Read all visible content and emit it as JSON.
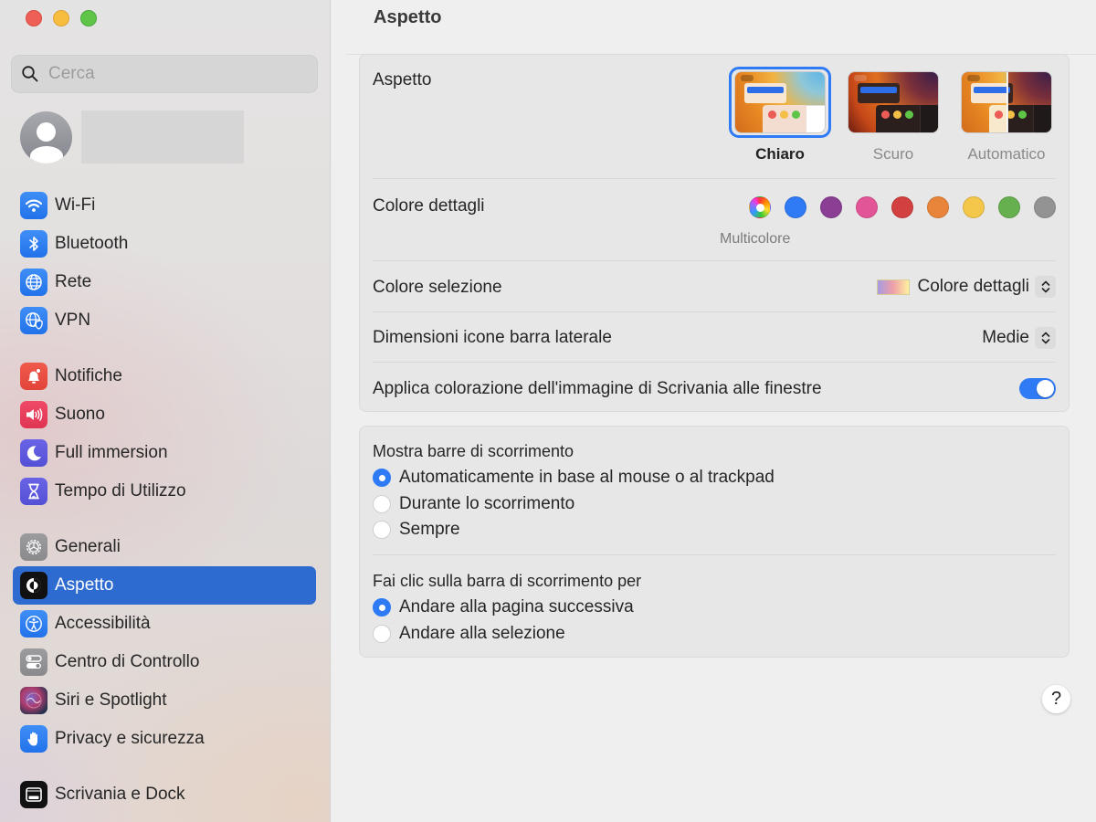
{
  "window": {
    "traffic_lights": [
      "close",
      "minimize",
      "zoom"
    ]
  },
  "sidebar": {
    "search": {
      "placeholder": "Cerca",
      "value": ""
    },
    "items": [
      {
        "id": "wifi",
        "label": "Wi-Fi",
        "icon": "wifi-icon",
        "icon_bg": "blue"
      },
      {
        "id": "bluetooth",
        "label": "Bluetooth",
        "icon": "bluetooth-icon",
        "icon_bg": "blue"
      },
      {
        "id": "rete",
        "label": "Rete",
        "icon": "globe-icon",
        "icon_bg": "blue"
      },
      {
        "id": "vpn",
        "label": "VPN",
        "icon": "vpn-globe-shield-icon",
        "icon_bg": "blue"
      },
      {
        "id": "notifiche",
        "label": "Notifiche",
        "icon": "bell-icon",
        "icon_bg": "red"
      },
      {
        "id": "suono",
        "label": "Suono",
        "icon": "speaker-icon",
        "icon_bg": "pink"
      },
      {
        "id": "full-immersion",
        "label": "Full immersion",
        "icon": "moon-icon",
        "icon_bg": "indigo"
      },
      {
        "id": "tempo",
        "label": "Tempo di Utilizzo",
        "icon": "hourglass-icon",
        "icon_bg": "indigo"
      },
      {
        "id": "generali",
        "label": "Generali",
        "icon": "gear-icon",
        "icon_bg": "gray"
      },
      {
        "id": "aspetto",
        "label": "Aspetto",
        "icon": "appearance-icon",
        "icon_bg": "black",
        "selected": true
      },
      {
        "id": "accessibilita",
        "label": "Accessibilità",
        "icon": "accessibility-icon",
        "icon_bg": "blue"
      },
      {
        "id": "centro-controllo",
        "label": "Centro di Controllo",
        "icon": "control-center-icon",
        "icon_bg": "gray"
      },
      {
        "id": "siri",
        "label": "Siri e Spotlight",
        "icon": "siri-icon",
        "icon_bg": "siri"
      },
      {
        "id": "privacy",
        "label": "Privacy e sicurezza",
        "icon": "hand-icon",
        "icon_bg": "blue"
      },
      {
        "id": "scrivania",
        "label": "Scrivania e Dock",
        "icon": "desktop-dock-icon",
        "icon_bg": "black"
      }
    ]
  },
  "main": {
    "title": "Aspetto",
    "appearance": {
      "label": "Aspetto",
      "options": [
        {
          "label": "Chiaro",
          "selected": true
        },
        {
          "label": "Scuro",
          "selected": false
        },
        {
          "label": "Automatico",
          "selected": false
        }
      ]
    },
    "accent": {
      "label": "Colore dettagli",
      "selected_label": "Multicolore",
      "colors": [
        {
          "name": "Multicolore",
          "hex": "multicolor",
          "selected": true
        },
        {
          "name": "blue",
          "hex": "#2f7bf5"
        },
        {
          "name": "purple",
          "hex": "#8a3f95"
        },
        {
          "name": "pink",
          "hex": "#e25597"
        },
        {
          "name": "red",
          "hex": "#d2413f"
        },
        {
          "name": "orange",
          "hex": "#e8853a"
        },
        {
          "name": "yellow",
          "hex": "#f4c74b"
        },
        {
          "name": "green",
          "hex": "#67b04f"
        },
        {
          "name": "graphite",
          "hex": "#939393"
        }
      ]
    },
    "highlight": {
      "label": "Colore selezione",
      "value": "Colore dettagli"
    },
    "sidebar_icon_size": {
      "label": "Dimensioni icone barra laterale",
      "value": "Medie"
    },
    "wallpaper_tinting": {
      "label": "Applica colorazione dell'immagine di Scrivania alle finestre",
      "enabled": true
    },
    "show_scroll_bars": {
      "title": "Mostra barre di scorrimento",
      "options": [
        {
          "label": "Automaticamente in base al mouse o al trackpad",
          "checked": true
        },
        {
          "label": "Durante lo scorrimento",
          "checked": false
        },
        {
          "label": "Sempre",
          "checked": false
        }
      ]
    },
    "click_scroll_bar": {
      "title": "Fai clic sulla barra di scorrimento per",
      "options": [
        {
          "label": "Andare alla pagina successiva",
          "checked": true
        },
        {
          "label": "Andare alla selezione",
          "checked": false
        }
      ]
    },
    "help_label": "?"
  }
}
